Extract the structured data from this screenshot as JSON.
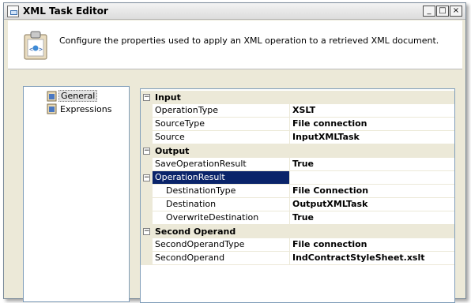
{
  "window": {
    "title": "XML Task Editor",
    "minimize_glyph": "_",
    "maximize_glyph": "□",
    "close_glyph": "×"
  },
  "header": {
    "description": "Configure the properties used to apply an XML operation to a retrieved XML document."
  },
  "nav": {
    "items": [
      {
        "label": "General",
        "selected": true,
        "icon": "property-page-icon"
      },
      {
        "label": "Expressions",
        "selected": false,
        "icon": "property-page-icon"
      }
    ]
  },
  "grid": {
    "toggle_glyph": "−",
    "categories": [
      {
        "label": "Input",
        "properties": [
          {
            "name": "OperationType",
            "value": "XSLT"
          },
          {
            "name": "SourceType",
            "value": "File connection"
          },
          {
            "name": "Source",
            "value": "InputXMLTask"
          }
        ]
      },
      {
        "label": "Output",
        "properties": [
          {
            "name": "SaveOperationResult",
            "value": "True"
          },
          {
            "name": "OperationResult",
            "value": "",
            "selected": true,
            "expandable": true
          },
          {
            "name": "DestinationType",
            "value": "File Connection",
            "indent": true
          },
          {
            "name": "Destination",
            "value": "OutputXMLTask",
            "indent": true
          },
          {
            "name": "OverwriteDestination",
            "value": "True",
            "indent": true
          }
        ]
      },
      {
        "label": "Second Operand",
        "properties": [
          {
            "name": "SecondOperandType",
            "value": "File connection"
          },
          {
            "name": "SecondOperand",
            "value": "IndContractStyleSheet.xslt"
          }
        ]
      }
    ]
  },
  "colors": {
    "selection": "#0a246a",
    "category_bg": "#ece9d8",
    "border": "#7f9db9"
  }
}
